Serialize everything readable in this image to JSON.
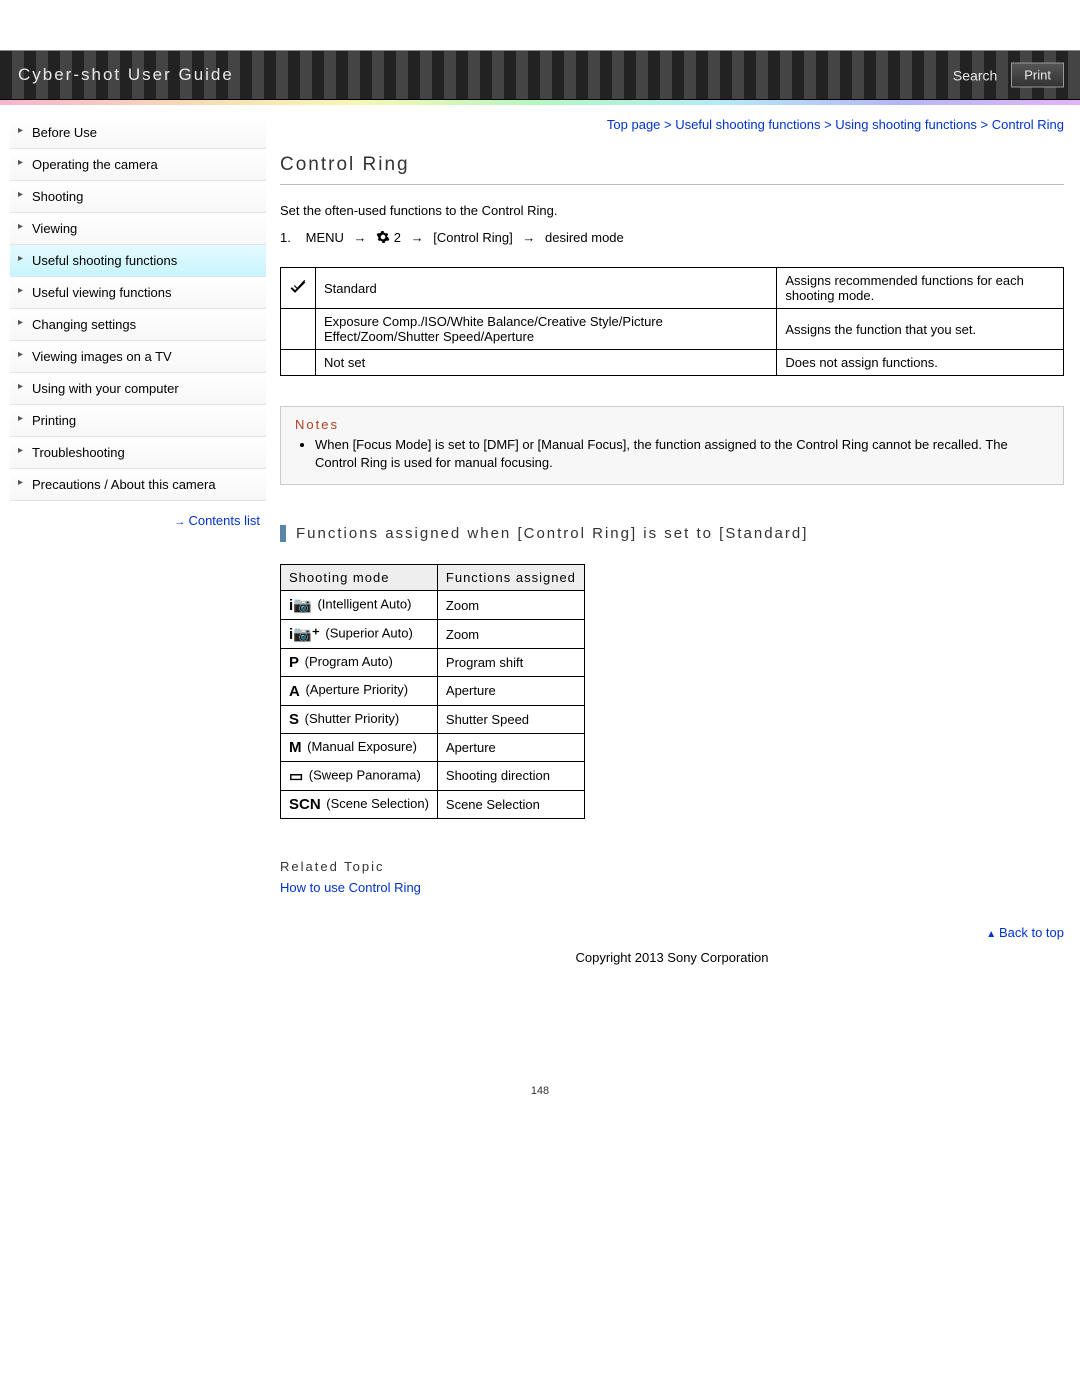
{
  "header": {
    "title": "Cyber-shot User Guide",
    "search_label": "Search",
    "print_label": "Print"
  },
  "sidebar": {
    "items": [
      {
        "label": "Before Use"
      },
      {
        "label": "Operating the camera"
      },
      {
        "label": "Shooting"
      },
      {
        "label": "Viewing"
      },
      {
        "label": "Useful shooting functions",
        "active": true
      },
      {
        "label": "Useful viewing functions"
      },
      {
        "label": "Changing settings"
      },
      {
        "label": "Viewing images on a TV"
      },
      {
        "label": "Using with your computer"
      },
      {
        "label": "Printing"
      },
      {
        "label": "Troubleshooting"
      },
      {
        "label": "Precautions / About this camera"
      }
    ],
    "contents_list_label": "Contents list"
  },
  "breadcrumb": {
    "parts": [
      "Top page",
      "Useful shooting functions",
      "Using shooting functions",
      "Control Ring"
    ],
    "separator": " > "
  },
  "page": {
    "title": "Control Ring",
    "intro": "Set the often-used functions to the Control Ring.",
    "step": {
      "num": "1.",
      "menu_label": "MENU",
      "settings_number": "2",
      "bracket_label": "[Control Ring]",
      "desired": "desired mode"
    }
  },
  "options_table": {
    "rows": [
      {
        "icon": "check",
        "name": "Standard",
        "desc": "Assigns recommended functions for each shooting mode."
      },
      {
        "icon": "",
        "name": "Exposure Comp./ISO/White Balance/Creative Style/Picture Effect/Zoom/Shutter Speed/Aperture",
        "desc": "Assigns the function that you set."
      },
      {
        "icon": "",
        "name": "Not set",
        "desc": "Does not assign functions."
      }
    ]
  },
  "notes": {
    "title": "Notes",
    "items": [
      "When [Focus Mode] is set to [DMF] or [Manual Focus], the function assigned to the Control Ring cannot be recalled. The Control Ring is used for manual focusing."
    ]
  },
  "subheading": "Functions assigned when [Control Ring] is set to [Standard]",
  "modes_table": {
    "headers": [
      "Shooting mode",
      "Functions assigned"
    ],
    "rows": [
      {
        "icon": "i📷",
        "mode": "(Intelligent Auto)",
        "func": "Zoom"
      },
      {
        "icon": "i📷⁺",
        "mode": "(Superior Auto)",
        "func": "Zoom"
      },
      {
        "icon": "P",
        "mode": "(Program Auto)",
        "func": "Program shift"
      },
      {
        "icon": "A",
        "mode": "(Aperture Priority)",
        "func": "Aperture"
      },
      {
        "icon": "S",
        "mode": "(Shutter Priority)",
        "func": "Shutter Speed"
      },
      {
        "icon": "M",
        "mode": "(Manual Exposure)",
        "func": "Aperture"
      },
      {
        "icon": "▭",
        "mode": "(Sweep Panorama)",
        "func": "Shooting direction"
      },
      {
        "icon": "SCN",
        "mode": "(Scene Selection)",
        "func": "Scene Selection"
      }
    ]
  },
  "related": {
    "title": "Related Topic",
    "link_label": "How to use Control Ring"
  },
  "footer": {
    "back_to_top": "Back to top",
    "copyright": "Copyright 2013 Sony Corporation",
    "page_number": "148"
  }
}
